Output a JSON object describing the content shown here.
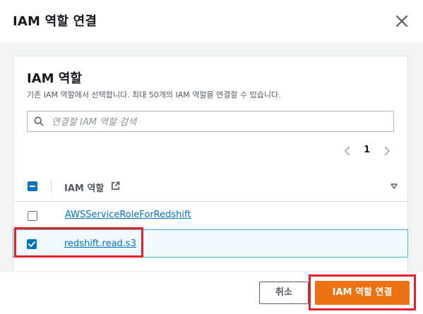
{
  "modal": {
    "title": "IAM 역할 연결",
    "close_icon": "close-icon"
  },
  "panel": {
    "title": "IAM 역할",
    "description": "기존 IAM 역할에서 선택합니다. 최대 50개의 IAM 역할을 연결할 수 있습니다.",
    "search": {
      "placeholder": "연결할 IAM 역할 검색",
      "value": "",
      "icon": "search-icon"
    },
    "pagination": {
      "current_page": "1"
    }
  },
  "table": {
    "column_header": "IAM 역할",
    "header_checkbox": "indeterminate",
    "rows": [
      {
        "name": "AWSServiceRoleForRedshift",
        "selected": false
      },
      {
        "name": "redshift.read.s3",
        "selected": true
      }
    ]
  },
  "footer": {
    "cancel_label": "취소",
    "submit_label": "IAM 역할 연결"
  },
  "colors": {
    "accent": "#ec7211",
    "link": "#0073bb",
    "highlight": "#e32028",
    "selected_row_bg": "#f1faff"
  }
}
